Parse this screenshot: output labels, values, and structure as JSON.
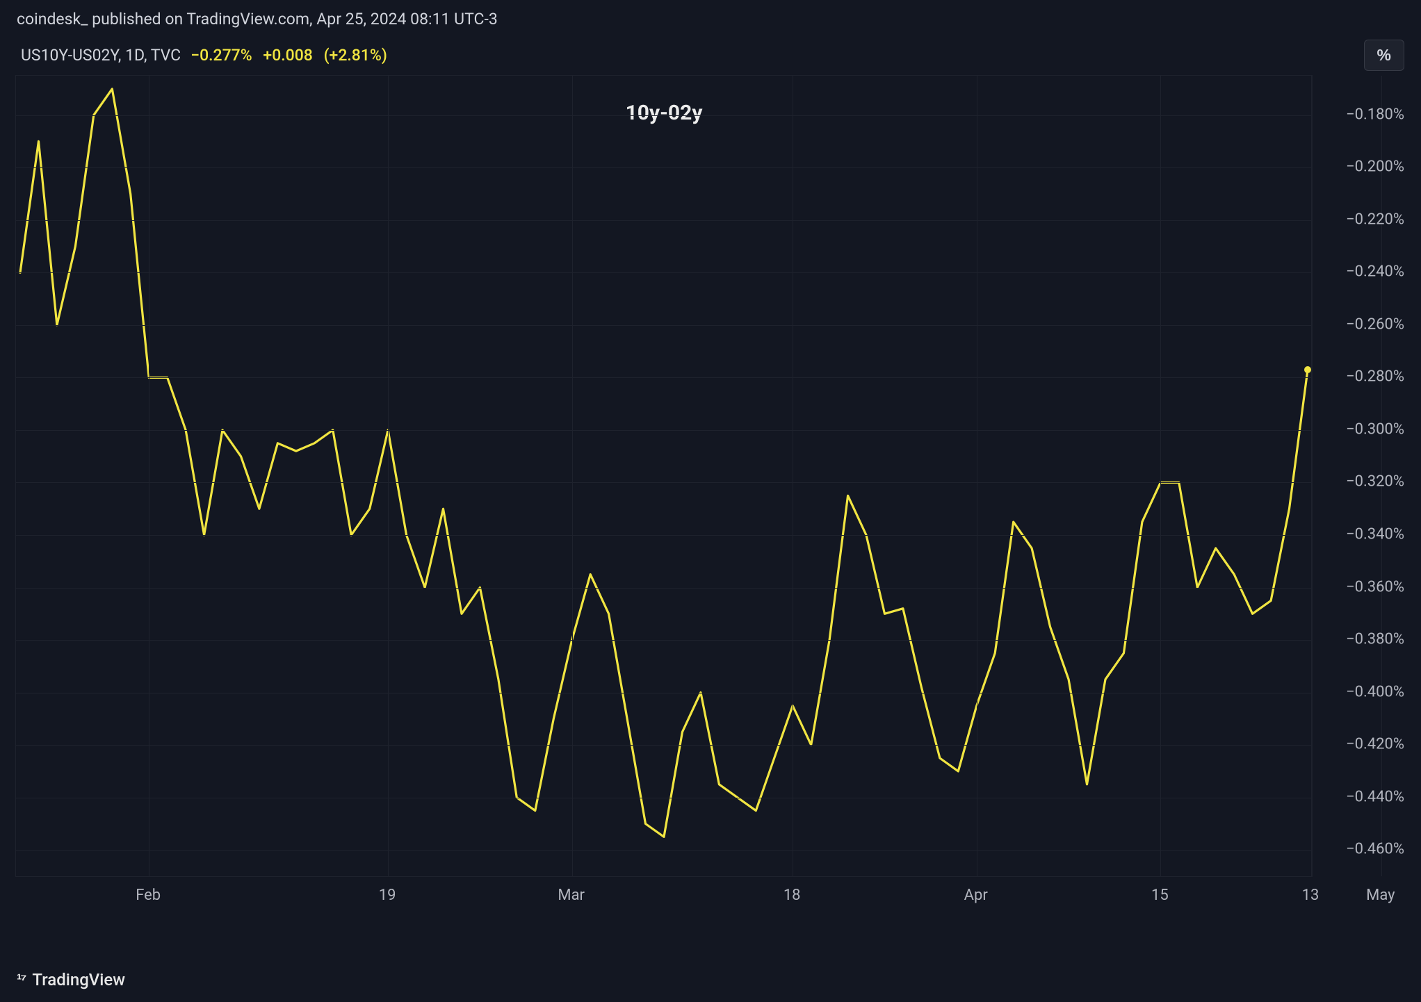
{
  "header": {
    "publish_line": "coindesk_ published on TradingView.com, Apr 25, 2024 08:11 UTC-3"
  },
  "legend": {
    "symbol": "US10Y-US02Y, 1D, TVC",
    "last": "−0.277%",
    "change_abs": "+0.008",
    "change_pct": "(+2.81%)",
    "pct_button": "%"
  },
  "footer": {
    "brand": "TradingView"
  },
  "chart_data": {
    "type": "line",
    "title": "10y-02y",
    "xlabel": "",
    "ylabel": "",
    "ylim": [
      -0.47,
      -0.165
    ],
    "y_ticks": [
      -0.18,
      -0.2,
      -0.22,
      -0.24,
      -0.26,
      -0.28,
      -0.3,
      -0.32,
      -0.34,
      -0.36,
      -0.38,
      -0.4,
      -0.42,
      -0.44,
      -0.46
    ],
    "y_tick_labels": [
      "−0.180%",
      "−0.200%",
      "−0.220%",
      "−0.240%",
      "−0.260%",
      "−0.280%",
      "−0.300%",
      "−0.320%",
      "−0.340%",
      "−0.360%",
      "−0.380%",
      "−0.400%",
      "−0.420%",
      "−0.440%",
      "−0.460%"
    ],
    "x_tick_positions": [
      7,
      20,
      30,
      42,
      52,
      62,
      74
    ],
    "x_tick_labels": [
      "Feb",
      "19",
      "Mar",
      "18",
      "Apr",
      "15",
      "May"
    ],
    "x_minor_tick_positions": [
      84
    ],
    "x_minor_tick_labels": [
      "13"
    ],
    "series": [
      {
        "name": "US10Y-US02Y",
        "color": "#f1e541",
        "values": [
          -0.24,
          -0.19,
          -0.26,
          -0.23,
          -0.18,
          -0.17,
          -0.21,
          -0.28,
          -0.28,
          -0.3,
          -0.34,
          -0.3,
          -0.31,
          -0.33,
          -0.305,
          -0.308,
          -0.305,
          -0.3,
          -0.34,
          -0.33,
          -0.3,
          -0.34,
          -0.36,
          -0.33,
          -0.37,
          -0.36,
          -0.395,
          -0.44,
          -0.445,
          -0.41,
          -0.38,
          -0.355,
          -0.37,
          -0.41,
          -0.45,
          -0.455,
          -0.415,
          -0.4,
          -0.435,
          -0.44,
          -0.445,
          -0.425,
          -0.405,
          -0.42,
          -0.38,
          -0.325,
          -0.34,
          -0.37,
          -0.368,
          -0.398,
          -0.425,
          -0.43,
          -0.405,
          -0.385,
          -0.335,
          -0.345,
          -0.375,
          -0.395,
          -0.435,
          -0.395,
          -0.385,
          -0.335,
          -0.32,
          -0.32,
          -0.36,
          -0.345,
          -0.355,
          -0.37,
          -0.365,
          -0.33,
          -0.277
        ]
      }
    ]
  }
}
